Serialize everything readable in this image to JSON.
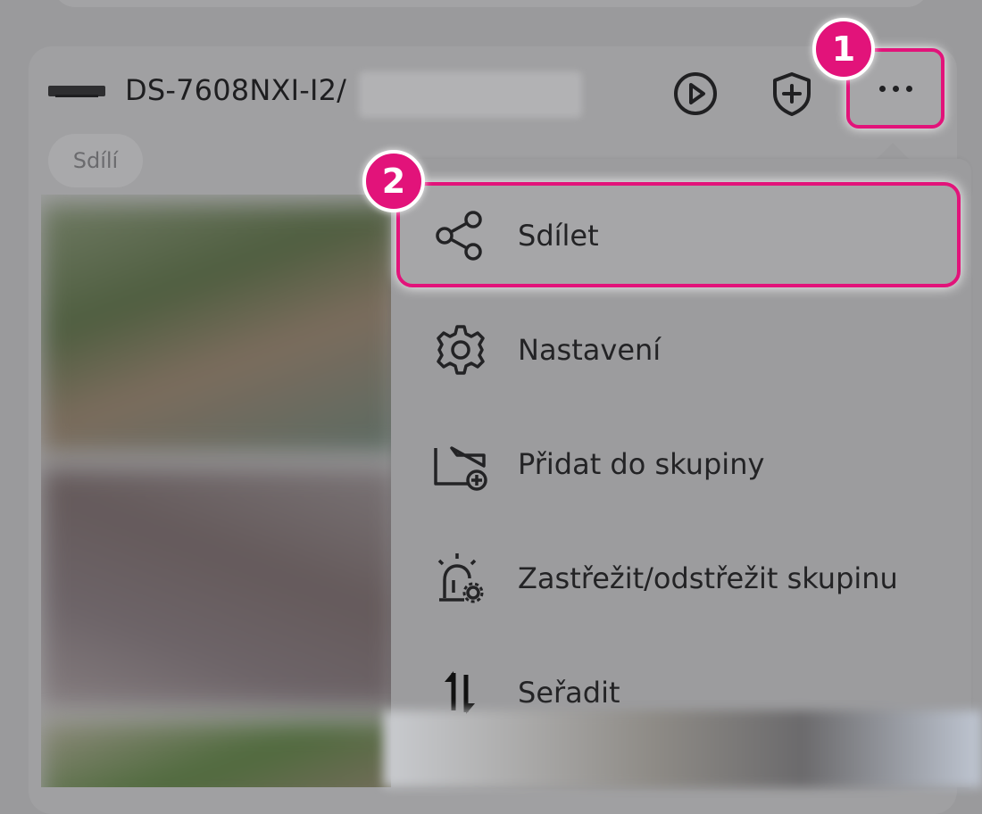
{
  "device": {
    "title": "DS-7608NXI-I2/",
    "chip_label": "Sdílí"
  },
  "header": {
    "play_icon": "play-circle-icon",
    "shield_icon": "shield-plus-icon",
    "more_icon": "more-horizontal-icon"
  },
  "menu": {
    "items": [
      {
        "label": "Sdílet",
        "icon": "share-icon"
      },
      {
        "label": "Nastavení",
        "icon": "gear-icon"
      },
      {
        "label": "Přidat do skupiny",
        "icon": "folder-add-icon"
      },
      {
        "label": "Zastřežit/odstřežit skupinu",
        "icon": "alarm-settings-icon"
      },
      {
        "label": "Seřadit",
        "icon": "sort-icon"
      }
    ]
  },
  "annotations": {
    "badge_1": "1",
    "badge_2": "2",
    "accent_color": "#e2137a"
  }
}
